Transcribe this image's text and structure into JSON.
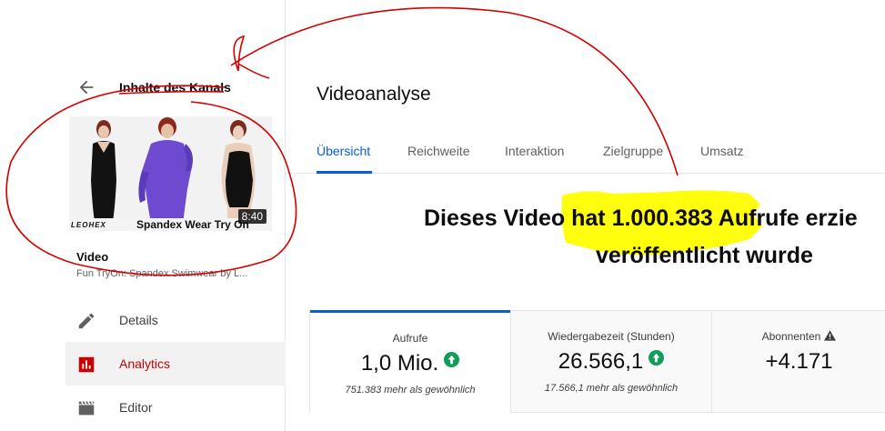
{
  "sidebar": {
    "back_label": "Inhalte des Kanals",
    "thumbnail": {
      "brand": "LEOHEX",
      "caption": "Spandex Wear Try On",
      "duration": "8:40"
    },
    "video_heading": "Video",
    "video_title": "Fun TryOn: Spandex Swimwear by L...",
    "nav": [
      {
        "label": "Details",
        "icon": "pencil-icon"
      },
      {
        "label": "Analytics",
        "icon": "analytics-icon"
      },
      {
        "label": "Editor",
        "icon": "clapperboard-icon"
      }
    ]
  },
  "main": {
    "title": "Videoanalyse",
    "tabs": [
      "Übersicht",
      "Reichweite",
      "Interaktion",
      "Zielgruppe",
      "Umsatz"
    ],
    "active_tab": "Übersicht",
    "headline_line1": "Dieses Video hat 1.000.383 Aufrufe erzie",
    "headline_line2": "veröffentlicht wurde",
    "metrics": [
      {
        "label": "Aufrufe",
        "value": "1,0 Mio.",
        "note": "751.383 mehr als gewöhnlich",
        "trend": "up"
      },
      {
        "label": "Wiedergabezeit (Stunden)",
        "value": "26.566,1",
        "note": "17.566,1 mehr als gewöhnlich",
        "trend": "up"
      },
      {
        "label": "Abonnenten",
        "value": "+4.171",
        "note": "",
        "trend": "warning"
      }
    ]
  },
  "colors": {
    "accent": "#065fd4",
    "active_nav": "#cc0000",
    "trend_up": "#0f9d58",
    "annotation_red": "#d40000",
    "highlight_yellow": "#ffff00"
  }
}
